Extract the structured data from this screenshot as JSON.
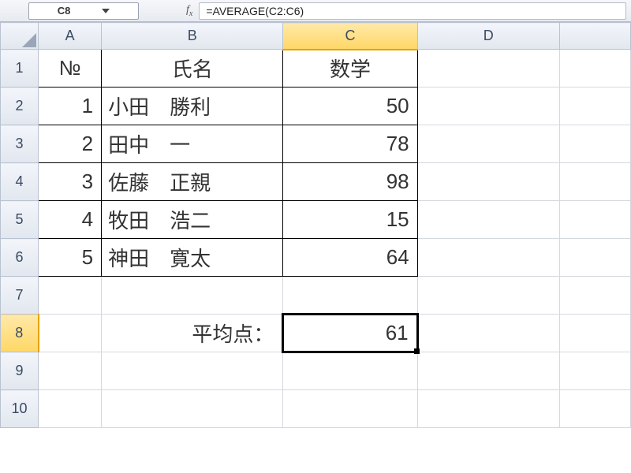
{
  "formula_bar": {
    "cell_ref": "C8",
    "fx_label": "fx",
    "formula": "=AVERAGE(C2:C6)"
  },
  "columns": [
    "A",
    "B",
    "C",
    "D"
  ],
  "rows": [
    "1",
    "2",
    "3",
    "4",
    "5",
    "6",
    "7",
    "8",
    "9",
    "10"
  ],
  "selected_cell": "C8",
  "headers": {
    "no": "№",
    "name": "氏名",
    "subject": "数学"
  },
  "students": [
    {
      "no": "1",
      "name": "小田　勝利",
      "score": "50"
    },
    {
      "no": "2",
      "name": "田中　一",
      "score": "78"
    },
    {
      "no": "3",
      "name": "佐藤　正親",
      "score": "98"
    },
    {
      "no": "4",
      "name": "牧田　浩二",
      "score": "15"
    },
    {
      "no": "5",
      "name": "神田　寛太",
      "score": "64"
    }
  ],
  "average": {
    "label": "平均点：",
    "value": "61"
  },
  "chart_data": {
    "type": "table",
    "title": "数学",
    "categories": [
      "小田　勝利",
      "田中　一",
      "佐藤　正親",
      "牧田　浩二",
      "神田　寛太"
    ],
    "values": [
      50,
      78,
      98,
      15,
      64
    ],
    "average": 61,
    "xlabel": "氏名",
    "ylabel": "数学"
  }
}
